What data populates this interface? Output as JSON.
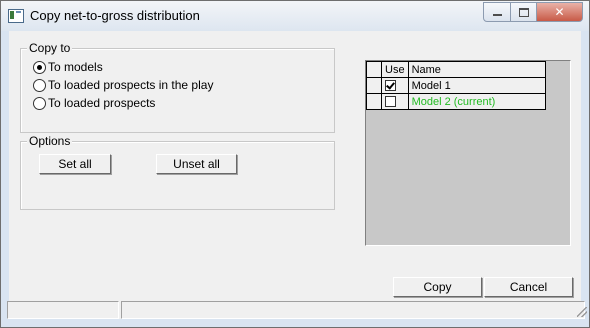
{
  "window": {
    "title": "Copy net-to-gross distribution",
    "icon": "app-window-icon"
  },
  "copy_to": {
    "legend": "Copy to",
    "options": [
      {
        "label": "To models",
        "checked": true
      },
      {
        "label": "To loaded prospects in the play",
        "checked": false
      },
      {
        "label": "To loaded prospects",
        "checked": false
      }
    ]
  },
  "options_group": {
    "legend": "Options",
    "set_all": "Set all",
    "unset_all": "Unset all"
  },
  "grid": {
    "headers": {
      "use": "Use",
      "name": "Name"
    },
    "rows": [
      {
        "use": true,
        "name": "Model 1",
        "color": "#000000"
      },
      {
        "use": false,
        "name": "Model 2   (current)",
        "color": "#22bb22"
      }
    ]
  },
  "footer": {
    "copy": "Copy",
    "cancel": "Cancel"
  },
  "colors": {
    "current_model": "#22bb22"
  }
}
